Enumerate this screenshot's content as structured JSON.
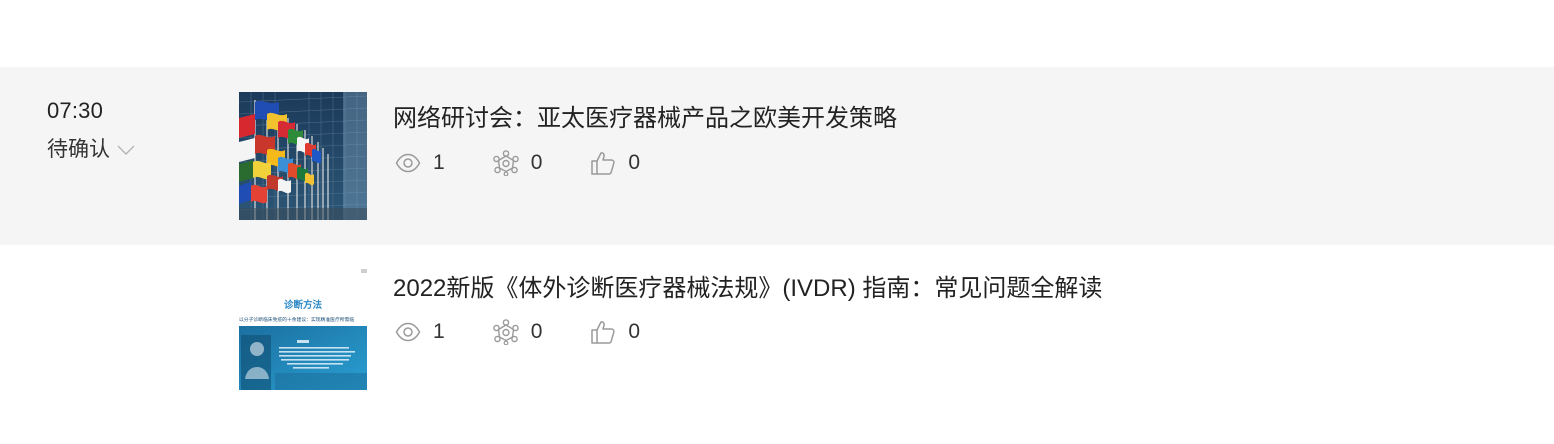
{
  "items": [
    {
      "time": "07:30",
      "status": "待确认",
      "status_icon": "chevron-down-icon",
      "title": "网络研讨会：亚太医疗器械产品之欧美开发策略",
      "thumbnail": "eu-flags-building-photo",
      "views": "1",
      "shares": "0",
      "likes": "0"
    },
    {
      "title": "2022新版《体外诊断医疗器械法规》(IVDR) 指南：常见问题全解读",
      "thumbnail": "diagnosis-method-slide",
      "thumbnail_text": {
        "heading": "诊断方法",
        "subheading": "以分子诊断临床免疫的十余建议：实现精准医疗所需临"
      },
      "views": "1",
      "shares": "0",
      "likes": "0"
    }
  ],
  "colors": {
    "row_highlight": "#f5f5f5",
    "icon": "#9a9a9a",
    "text": "#222222"
  }
}
